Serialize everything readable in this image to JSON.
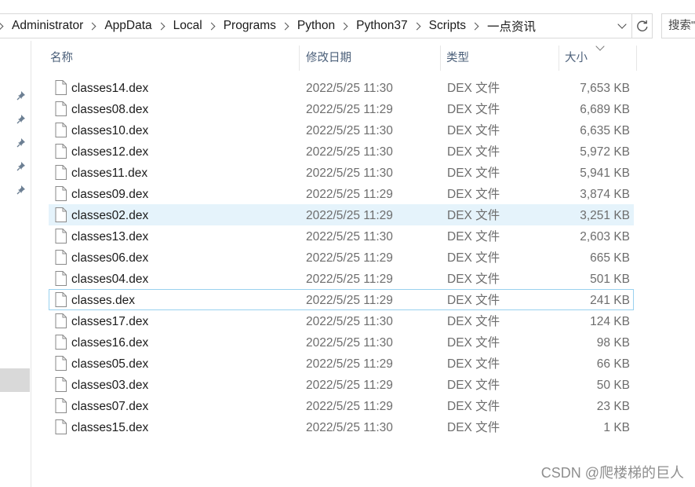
{
  "address_bar": {
    "breadcrumbs": [
      "Administrator",
      "AppData",
      "Local",
      "Programs",
      "Python",
      "Python37",
      "Scripts",
      "一点资讯"
    ]
  },
  "search": {
    "placeholder": "搜索\""
  },
  "columns": {
    "name": "名称",
    "date": "修改日期",
    "type": "类型",
    "size": "大小",
    "sorted_by": "size",
    "sort_direction": "descending"
  },
  "files": [
    {
      "name": "classes14.dex",
      "date": "2022/5/25 11:30",
      "type": "DEX 文件",
      "size": "7,653 KB"
    },
    {
      "name": "classes08.dex",
      "date": "2022/5/25 11:29",
      "type": "DEX 文件",
      "size": "6,689 KB"
    },
    {
      "name": "classes10.dex",
      "date": "2022/5/25 11:30",
      "type": "DEX 文件",
      "size": "6,635 KB"
    },
    {
      "name": "classes12.dex",
      "date": "2022/5/25 11:30",
      "type": "DEX 文件",
      "size": "5,972 KB"
    },
    {
      "name": "classes11.dex",
      "date": "2022/5/25 11:30",
      "type": "DEX 文件",
      "size": "5,941 KB"
    },
    {
      "name": "classes09.dex",
      "date": "2022/5/25 11:29",
      "type": "DEX 文件",
      "size": "3,874 KB"
    },
    {
      "name": "classes02.dex",
      "date": "2022/5/25 11:29",
      "type": "DEX 文件",
      "size": "3,251 KB",
      "hover": true
    },
    {
      "name": "classes13.dex",
      "date": "2022/5/25 11:30",
      "type": "DEX 文件",
      "size": "2,603 KB"
    },
    {
      "name": "classes06.dex",
      "date": "2022/5/25 11:29",
      "type": "DEX 文件",
      "size": "665 KB"
    },
    {
      "name": "classes04.dex",
      "date": "2022/5/25 11:29",
      "type": "DEX 文件",
      "size": "501 KB"
    },
    {
      "name": "classes.dex",
      "date": "2022/5/25 11:29",
      "type": "DEX 文件",
      "size": "241 KB",
      "focused": true
    },
    {
      "name": "classes17.dex",
      "date": "2022/5/25 11:30",
      "type": "DEX 文件",
      "size": "124 KB"
    },
    {
      "name": "classes16.dex",
      "date": "2022/5/25 11:30",
      "type": "DEX 文件",
      "size": "98 KB"
    },
    {
      "name": "classes05.dex",
      "date": "2022/5/25 11:29",
      "type": "DEX 文件",
      "size": "66 KB"
    },
    {
      "name": "classes03.dex",
      "date": "2022/5/25 11:29",
      "type": "DEX 文件",
      "size": "50 KB"
    },
    {
      "name": "classes07.dex",
      "date": "2022/5/25 11:29",
      "type": "DEX 文件",
      "size": "23 KB"
    },
    {
      "name": "classes15.dex",
      "date": "2022/5/25 11:30",
      "type": "DEX 文件",
      "size": "1 KB"
    }
  ],
  "navigation_pane": {
    "pinned_icons": [
      "pin-icon",
      "pin-icon",
      "pin-icon",
      "pin-icon",
      "pin-icon"
    ]
  },
  "watermark": "CSDN @爬楼梯的巨人",
  "colors": {
    "hover_row": "#e5f3fb",
    "focus_border": "#99d1ef",
    "header_text": "#4c607a",
    "secondary_text": "#6d6d6d"
  }
}
